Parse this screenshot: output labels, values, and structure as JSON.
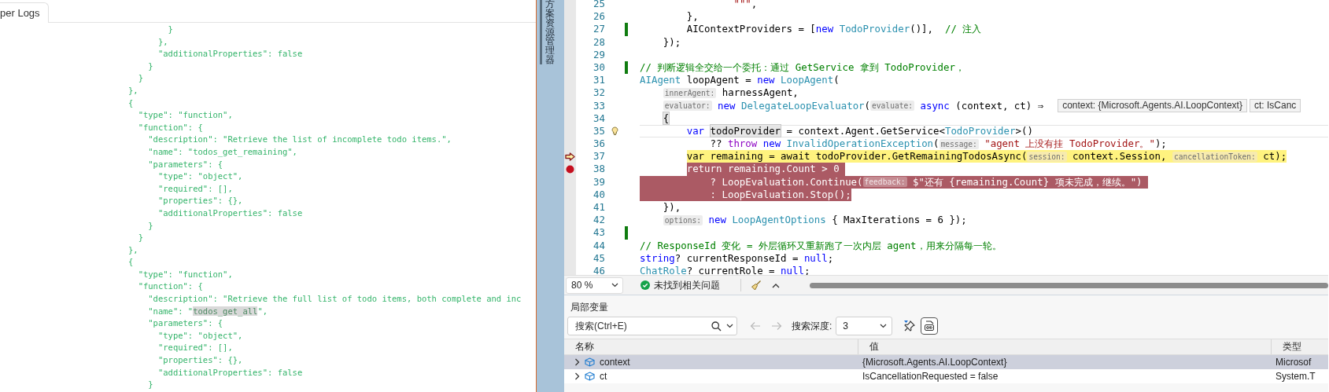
{
  "log_panel": {
    "tab": {
      "label": "per Logs",
      "selected": true
    },
    "lines": [
      {
        "text": "        }"
      },
      {
        "text": "      },"
      },
      {
        "text": "      \"additionalProperties\": false"
      },
      {
        "text": "    }"
      },
      {
        "text": "  }"
      },
      {
        "text": "},"
      },
      {
        "text": "{"
      },
      {
        "text": "  \"type\": \"function\","
      },
      {
        "text": "  \"function\": {"
      },
      {
        "text": "    \"description\": \"Retrieve the list of incomplete todo items.\","
      },
      {
        "text": "    \"name\": \"todos_get_remaining\","
      },
      {
        "text": "    \"parameters\": {"
      },
      {
        "text": "      \"type\": \"object\","
      },
      {
        "text": "      \"required\": [],"
      },
      {
        "text": "      \"properties\": {},"
      },
      {
        "text": "      \"additionalProperties\": false"
      },
      {
        "text": "    }"
      },
      {
        "text": "  }"
      },
      {
        "text": "},"
      },
      {
        "text": "{"
      },
      {
        "text": "  \"type\": \"function\","
      },
      {
        "text": "  \"function\": {"
      },
      {
        "text": "    \"description\": \"Retrieve the full list of todo items, both complete and inc"
      },
      {
        "before": "    \"name\": \"",
        "match": "todos_get_all",
        "after": "\","
      },
      {
        "text": "    \"parameters\": {"
      },
      {
        "text": "      \"type\": \"object\","
      },
      {
        "text": "      \"required\": [],"
      },
      {
        "text": "      \"properties\": {},"
      },
      {
        "text": "      \"additionalProperties\": false"
      },
      {
        "text": "    }"
      }
    ]
  },
  "sidebar": {
    "label": "方案资源管理器"
  },
  "editor": {
    "lines": [
      {
        "children": [
          {
            "children": [
              {
                "children": [
                  {
                    "children": [
                      {
                        "no": "25",
                        "tokens": [
                          {
                            "kind": "str",
                            "text": "\"\"\""
                          },
                          {
                            "kind": "plain",
                            "text": ","
                          }
                        ]
                      }
                    ]
                  }
                ]
              },
              {
                "no": "26",
                "tokens": [
                  {
                    "kind": "plain",
                    "text": "},"
                  }
                ]
              },
              {
                "no": "27",
                "change": true,
                "tokens": [
                  {
                    "kind": "plain",
                    "text": "AIContextProviders = ["
                  },
                  {
                    "kind": "kw",
                    "text": "new "
                  },
                  {
                    "kind": "type",
                    "text": "TodoProvider"
                  },
                  {
                    "kind": "plain",
                    "text": "()],  "
                  },
                  {
                    "kind": "cmt",
                    "text": "// 注入"
                  }
                ]
              }
            ]
          },
          {
            "no": "28",
            "tokens": [
              {
                "kind": "plain",
                "text": "});"
              }
            ]
          }
        ]
      },
      {
        "no": "29"
      },
      {
        "no": "30",
        "change": true,
        "tokens": [
          {
            "kind": "cmt",
            "text": "// 判断逻辑全交给一个委托：通过 GetService 拿到 TodoProvider，"
          }
        ]
      },
      {
        "no": "31",
        "tokens": [
          {
            "kind": "type",
            "text": "AIAgent"
          },
          {
            "kind": "plain",
            "text": " loopAgent = "
          },
          {
            "kind": "kw",
            "text": "new "
          },
          {
            "kind": "type",
            "text": "LoopAgent"
          },
          {
            "kind": "plain",
            "text": "("
          }
        ],
        "children": [
          {
            "no": "32",
            "tokens": [
              {
                "kind": "hint",
                "text": "innerAgent:"
              },
              {
                "kind": "plain",
                "text": " harnessAgent,"
              }
            ]
          },
          {
            "no": "33",
            "tokens": [
              {
                "kind": "hint",
                "text": "evaluator:"
              },
              {
                "kind": "kw",
                "text": " new "
              },
              {
                "kind": "type",
                "text": "DelegateLoopEvaluator"
              },
              {
                "kind": "plain",
                "text": "("
              },
              {
                "kind": "hint",
                "text": "evaluate:"
              },
              {
                "kind": "kw",
                "text": " async"
              },
              {
                "kind": "plain",
                "text": " (context, ct) ⇒"
              }
            ],
            "datatips": [
              "context: {Microsoft.Agents.AI.LoopContext}",
              "ct: IsCanc"
            ]
          },
          {
            "no": "34",
            "tokens": [
              {
                "kind": "ref",
                "text": "{"
              }
            ],
            "children": [
              {
                "no": "35",
                "active": true,
                "bulb": true,
                "tokens": [
                  {
                    "kind": "kw",
                    "text": "var "
                  },
                  {
                    "kind": "ref",
                    "text": "todoProvider"
                  },
                  {
                    "kind": "plain",
                    "text": " = context.Agent.GetService<"
                  },
                  {
                    "kind": "type",
                    "text": "TodoProvider"
                  },
                  {
                    "kind": "plain",
                    "text": ">()"
                  }
                ],
                "children": [
                  {
                    "no": "36",
                    "tokens": [
                      {
                        "kind": "plain",
                        "text": "?? "
                      },
                      {
                        "kind": "ctl",
                        "text": "throw"
                      },
                      {
                        "kind": "kw",
                        "text": " new "
                      },
                      {
                        "kind": "type",
                        "text": "InvalidOperationException"
                      },
                      {
                        "kind": "plain",
                        "text": "("
                      },
                      {
                        "kind": "hint",
                        "text": "message:"
                      },
                      {
                        "kind": "str",
                        "text": " \"agent 上没有挂 TodoProvider。\""
                      },
                      {
                        "kind": "plain",
                        "text": ");"
                      }
                    ]
                  }
                ]
              },
              {
                "no": "37",
                "execution_point": true,
                "tokens": [
                  {
                    "kind": "plain",
                    "text": "var remaining = await todoProvider.GetRemainingTodosAsync("
                  },
                  {
                    "kind": "hint",
                    "text": "session:"
                  },
                  {
                    "kind": "plain",
                    "text": " context.Session, "
                  },
                  {
                    "kind": "hint",
                    "text": "cancellationToken:"
                  },
                  {
                    "kind": "plain",
                    "text": " ct);"
                  }
                ]
              },
              {
                "no": "38",
                "breakpoint": true,
                "tokens": [
                  {
                    "kind": "plain",
                    "text": "return remaining.Count > 0 "
                  }
                ],
                "children": [
                  {
                    "no": "39",
                    "breakpoint_range": true,
                    "tokens": [
                      {
                        "kind": "plain",
                        "text": "? LoopEvaluation.Continue("
                      },
                      {
                        "kind": "hint",
                        "text": "feedback:"
                      },
                      {
                        "kind": "plain",
                        "text": " $\"还有 {remaining.Count} 项未完成，继续。\") "
                      }
                    ]
                  },
                  {
                    "no": "40",
                    "breakpoint_range": true,
                    "tokens": [
                      {
                        "kind": "plain",
                        "text": ": LoopEvaluation.Stop();"
                      }
                    ]
                  }
                ]
              }
            ]
          },
          {
            "no": "41",
            "tokens": [
              {
                "kind": "plain",
                "text": "}),"
              }
            ]
          },
          {
            "no": "42",
            "tokens": [
              {
                "kind": "hint",
                "text": "options:"
              },
              {
                "kind": "kw",
                "text": " new "
              },
              {
                "kind": "type",
                "text": "LoopAgentOptions"
              },
              {
                "kind": "plain",
                "text": " { MaxIterations = 6 });"
              }
            ]
          }
        ]
      },
      {
        "no": "43",
        "change": true
      },
      {
        "no": "44",
        "tokens": [
          {
            "kind": "cmt",
            "text": "// ResponseId 变化 = 外层循环又重新跑了一次内层 agent，用来分隔每一轮。"
          }
        ]
      },
      {
        "no": "45",
        "tokens": [
          {
            "kind": "kw",
            "text": "string"
          },
          {
            "kind": "plain",
            "text": "? currentResponseId = "
          },
          {
            "kind": "kw",
            "text": "null"
          },
          {
            "kind": "plain",
            "text": ";"
          }
        ]
      },
      {
        "no": "46",
        "tokens": [
          {
            "kind": "type",
            "text": "ChatRole"
          },
          {
            "kind": "plain",
            "text": "? currentRole = "
          },
          {
            "kind": "kw",
            "text": "null"
          },
          {
            "kind": "plain",
            "text": ";"
          }
        ]
      }
    ]
  },
  "status_bar": {
    "zoom": "80 %",
    "issues": "未找到相关问题"
  },
  "locals": {
    "title": "局部变量",
    "search": {
      "placeholder": "搜索(Ctrl+E)"
    },
    "back": {
      "disabled": true
    },
    "forward": {
      "disabled": true
    },
    "depth_label": "搜索深度:",
    "depth": "3",
    "columns": [
      "名称",
      "值",
      "类型"
    ],
    "rows": [
      {
        "name": "context",
        "value": "{Microsoft.Agents.AI.LoopContext}",
        "type": "Microsof",
        "selected": true
      },
      {
        "name": "ct",
        "value": "IsCancellationRequested = false",
        "type": "System.T",
        "selected": false
      }
    ]
  }
}
